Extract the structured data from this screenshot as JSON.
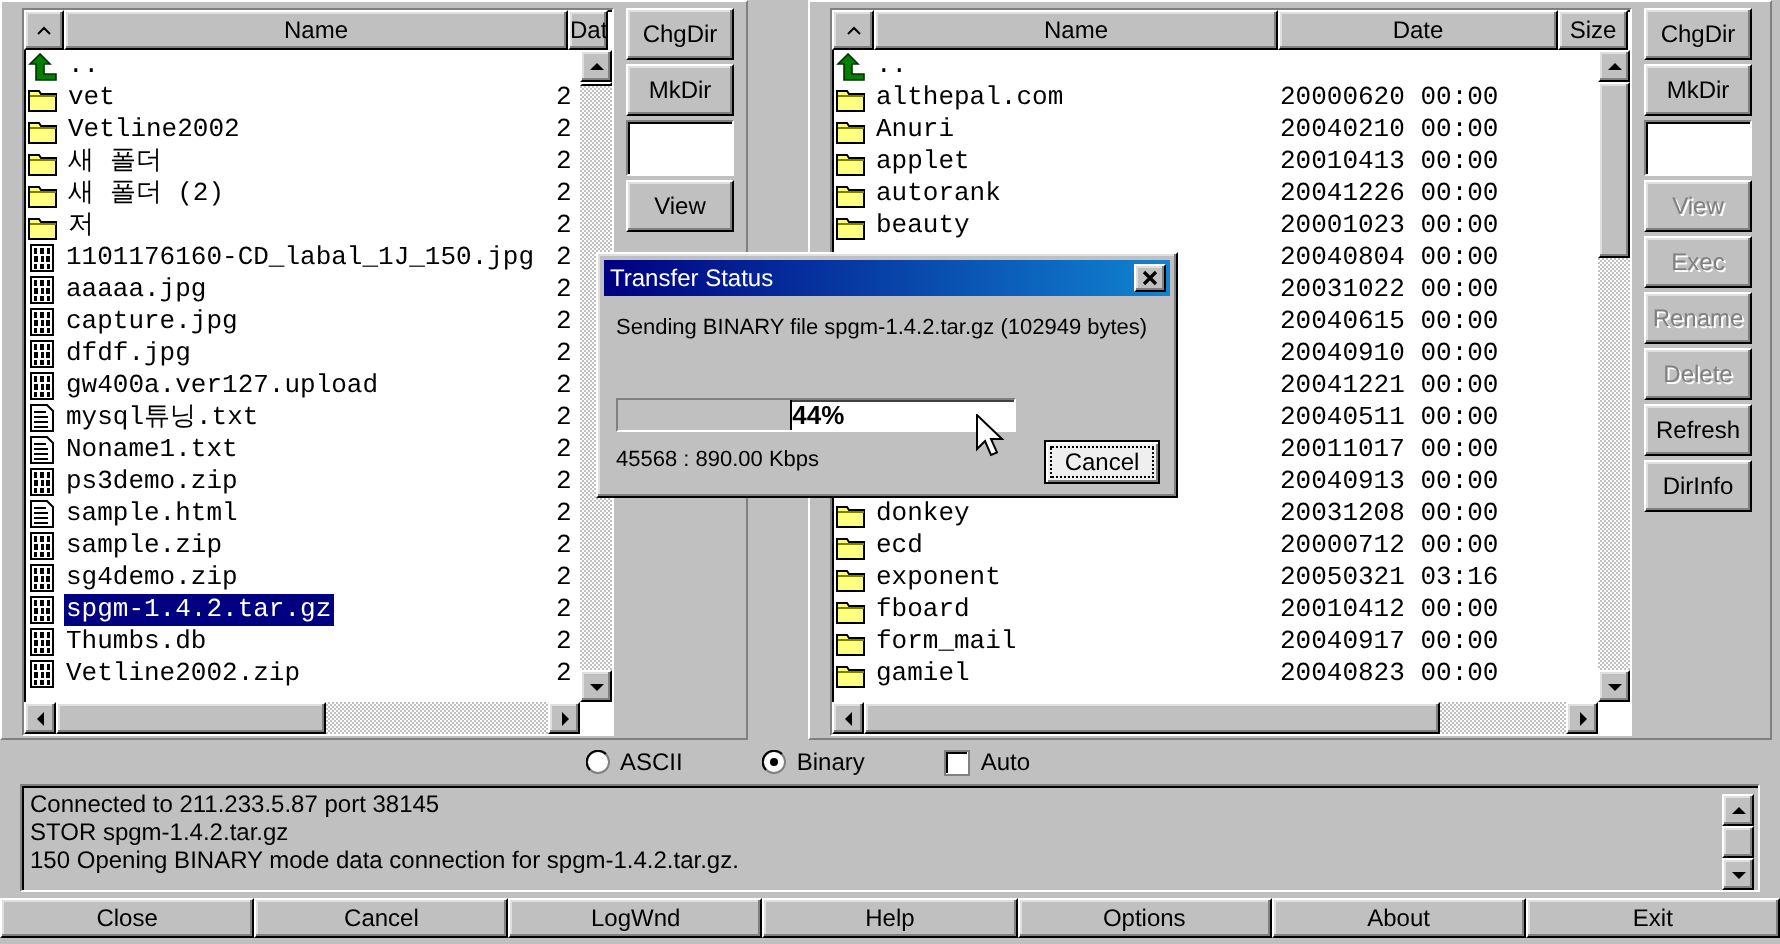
{
  "left_pane": {
    "columns": [
      "Name",
      "Dat"
    ],
    "rows": [
      {
        "kind": "up",
        "name": "..",
        "selected": false
      },
      {
        "kind": "folder",
        "name": "vet",
        "column_3": "2",
        "selected": false
      },
      {
        "kind": "folder",
        "name": "Vetline2002",
        "column_3": "2",
        "selected": false
      },
      {
        "kind": "folder",
        "name": "새 폴더",
        "column_3": "2",
        "selected": false
      },
      {
        "kind": "folder",
        "name": "새 폴더 (2)",
        "column_3": "2",
        "selected": false
      },
      {
        "kind": "folder",
        "name": "저",
        "column_3": "2",
        "selected": false
      },
      {
        "kind": "binary",
        "name": "1101176160-CD_labal_1J_150.jpg",
        "column_3": "2",
        "selected": false
      },
      {
        "kind": "binary",
        "name": "aaaaa.jpg",
        "column_3": "2",
        "selected": false
      },
      {
        "kind": "binary",
        "name": "capture.jpg",
        "column_3": "2",
        "selected": false
      },
      {
        "kind": "binary",
        "name": "dfdf.jpg",
        "column_3": "2",
        "selected": false
      },
      {
        "kind": "binary",
        "name": "gw400a.ver127.upload",
        "column_3": "2",
        "selected": false
      },
      {
        "kind": "text",
        "name": "mysql튜닝.txt",
        "column_3": "2",
        "selected": false
      },
      {
        "kind": "text",
        "name": "Noname1.txt",
        "column_3": "2",
        "selected": false
      },
      {
        "kind": "binary",
        "name": "ps3demo.zip",
        "column_3": "2",
        "selected": false
      },
      {
        "kind": "text",
        "name": "sample.html",
        "column_3": "2",
        "selected": false
      },
      {
        "kind": "binary",
        "name": "sample.zip",
        "column_3": "2",
        "selected": false
      },
      {
        "kind": "binary",
        "name": "sg4demo.zip",
        "column_3": "2",
        "selected": false
      },
      {
        "kind": "binary",
        "name": "spgm-1.4.2.tar.gz",
        "column_3": "2",
        "selected": true
      },
      {
        "kind": "binary",
        "name": "Thumbs.db",
        "column_3": "2",
        "selected": false
      },
      {
        "kind": "binary",
        "name": "Vetline2002.zip",
        "column_3": "2",
        "selected": false
      }
    ],
    "buttons": [
      {
        "kind": "button",
        "label": "ChgDir",
        "disabled": false
      },
      {
        "kind": "button",
        "label": "MkDir",
        "disabled": false
      },
      {
        "kind": "field"
      },
      {
        "kind": "button",
        "label": "View",
        "disabled": false
      }
    ]
  },
  "right_pane": {
    "columns": [
      "Name",
      "Date",
      "Size"
    ],
    "rows": [
      {
        "kind": "up",
        "name": "..",
        "selected": false
      },
      {
        "kind": "folder",
        "name": "althepal.com",
        "date": "20000620 00:00",
        "selected": false
      },
      {
        "kind": "folder",
        "name": "Anuri",
        "date": "20040210 00:00",
        "selected": false
      },
      {
        "kind": "folder",
        "name": "applet",
        "date": "20010413 00:00",
        "selected": false
      },
      {
        "kind": "folder",
        "name": "autorank",
        "date": "20041226 00:00",
        "selected": false
      },
      {
        "kind": "folder",
        "name": "beauty",
        "date": "20001023 00:00",
        "selected": false
      },
      {
        "kind": "covered",
        "date": "20040804 00:00",
        "selected": false
      },
      {
        "kind": "covered",
        "date": "20031022 00:00",
        "selected": false
      },
      {
        "kind": "covered",
        "date": "20040615 00:00",
        "selected": false
      },
      {
        "kind": "covered",
        "date": "20040910 00:00",
        "selected": false
      },
      {
        "kind": "covered",
        "date": "20041221 00:00",
        "selected": false
      },
      {
        "kind": "covered",
        "date": "20040511 00:00",
        "selected": false
      },
      {
        "kind": "covered",
        "date": "20011017 00:00",
        "selected": false
      },
      {
        "kind": "covered",
        "date": "20040913 00:00",
        "selected": false
      },
      {
        "kind": "folder",
        "name": "donkey",
        "date": "20031208 00:00",
        "selected": false
      },
      {
        "kind": "folder",
        "name": "ecd",
        "date": "20000712 00:00",
        "selected": false
      },
      {
        "kind": "folder",
        "name": "exponent",
        "date": "20050321 03:16",
        "selected": false
      },
      {
        "kind": "folder",
        "name": "fboard",
        "date": "20010412 00:00",
        "selected": false
      },
      {
        "kind": "folder",
        "name": "form_mail",
        "date": "20040917 00:00",
        "selected": false
      },
      {
        "kind": "folder",
        "name": "gamiel",
        "date": "20040823 00:00",
        "selected": false
      }
    ],
    "buttons": [
      {
        "kind": "button",
        "label": "ChgDir",
        "disabled": false
      },
      {
        "kind": "button",
        "label": "MkDir",
        "disabled": false
      },
      {
        "kind": "field"
      },
      {
        "kind": "button",
        "label": "View",
        "disabled": true
      },
      {
        "kind": "button",
        "label": "Exec",
        "disabled": true
      },
      {
        "kind": "button",
        "label": "Rename",
        "disabled": true
      },
      {
        "kind": "button",
        "label": "Delete",
        "disabled": true
      },
      {
        "kind": "button",
        "label": "Refresh",
        "disabled": false
      },
      {
        "kind": "button",
        "label": "DirInfo",
        "disabled": false
      }
    ]
  },
  "transfer_modes": [
    {
      "kind": "radio",
      "label": "ASCII",
      "selected": false
    },
    {
      "kind": "radio",
      "label": "Binary",
      "selected": true
    },
    {
      "kind": "checkbox",
      "label": "Auto",
      "checked": false
    }
  ],
  "log": [
    "Connected to 211.233.5.87 port 38145",
    "STOR spgm-1.4.2.tar.gz",
    "150 Opening BINARY mode data connection for spgm-1.4.2.tar.gz."
  ],
  "bottom_buttons": [
    "Close",
    "Cancel",
    "LogWnd",
    "Help",
    "Options",
    "About",
    "Exit"
  ],
  "dialog": {
    "title": "Transfer Status",
    "message": "Sending BINARY file spgm-1.4.2.tar.gz (102949 bytes)",
    "progress": {
      "level": 0.44,
      "label": "44%"
    },
    "rate": "45568 : 890.00 Kbps",
    "button": "Cancel"
  }
}
